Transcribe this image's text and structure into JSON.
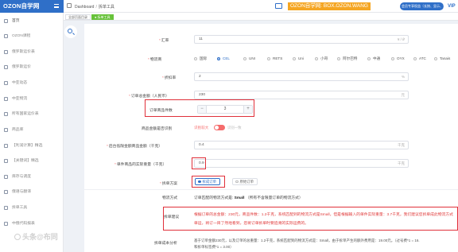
{
  "app": {
    "logo": "OZON自学网"
  },
  "header": {
    "breadcrumb": [
      "Dashboard",
      "拆单工具"
    ],
    "banner": "OZON自学网: BOX.OZON.WANG",
    "action_button": "会员专享权益（长按、显示、复制）",
    "vip": "VIP"
  },
  "tabs": [
    {
      "label": "全部页面目录"
    },
    {
      "label": "● 拆单工具",
      "active": true
    }
  ],
  "sidebar": {
    "items": [
      {
        "label": "首页"
      },
      {
        "label": "OZON课程"
      },
      {
        "label": "俄罗斯运价表"
      },
      {
        "label": "俄罗斯运价"
      },
      {
        "label": "中亚动态"
      },
      {
        "label": "中亚物流"
      },
      {
        "label": "所有国家运价表"
      },
      {
        "label": "商品库"
      },
      {
        "label": "【利润计算】精选"
      },
      {
        "label": "【关键词】精选"
      },
      {
        "label": "库存与调度"
      },
      {
        "label": "俄语与翻译"
      },
      {
        "label": "拆单工具"
      },
      {
        "label": "中俄代码报表"
      }
    ]
  },
  "form": {
    "rate": {
      "label": "汇率",
      "value": "11",
      "unit": "¥ / ₽"
    },
    "carrier": {
      "label": "物流商",
      "options": [
        "国际",
        "CEL",
        "UNI",
        "RETS",
        "Uni",
        "小哥",
        "阿尔巴特",
        "中通",
        "OYX",
        "ATC",
        "Tanais"
      ],
      "selected": "CEL"
    },
    "discount": {
      "label": "折扣率",
      "value": "2",
      "unit": "%"
    },
    "order_total": {
      "label": "订单总金额（人民币）",
      "value": "230",
      "unit": "元"
    },
    "item_count": {
      "label": "订单商品件数",
      "value": "3"
    },
    "toggle": {
      "label": "商品金额是否识别",
      "on_text": "识别较大",
      "off_text": "识别一致"
    },
    "platform_min": {
      "label": "后台低限金额商品金额（千克）",
      "value": "0.4",
      "unit": "千克"
    },
    "item_weight": {
      "label": "单件商品的实际重量（千克）",
      "value": "0.9",
      "unit": "千克"
    },
    "split_plan": {
      "label": "拆单方案",
      "options": [
        "拆成订单",
        "原始订单"
      ],
      "selected": "拆成订单"
    }
  },
  "result": {
    "shipping_label": "物流方式",
    "shipping_text": "订单匹配的物流方式是:",
    "shipping_value": "Small",
    "shipping_note": "（所有不含限量订单的物流方式）",
    "advice_label": "拆单建议",
    "advice_line1": "根据订单的总金额：230元，商品件数：1.2千克，系统匹配到的物流方式是Small，但是根据输入的单件实际重量：3.7千克，我们建议您拆单成此物流方式",
    "advice_line2": "单运，将订一目了然地看到，您将订单拆单时要追溯的实际运费的。",
    "cost_label": "拆单成本分析",
    "cost_line1": "基于订单金额230元，以及订单的总重量：1.2千克，系统匹配到的物流方式是：Small，由于拆单产生的额外费用是：19.00元。（过号费*1 = 16.",
    "cost_line2": "和拆单标签费*1 = 3.00）"
  },
  "watermark": "头条@布同",
  "colors": {
    "brand_blue": "#2f6fc8",
    "banner_orange": "#f5a623",
    "tab_green": "#67c23a",
    "warning_red": "#e0303a"
  }
}
